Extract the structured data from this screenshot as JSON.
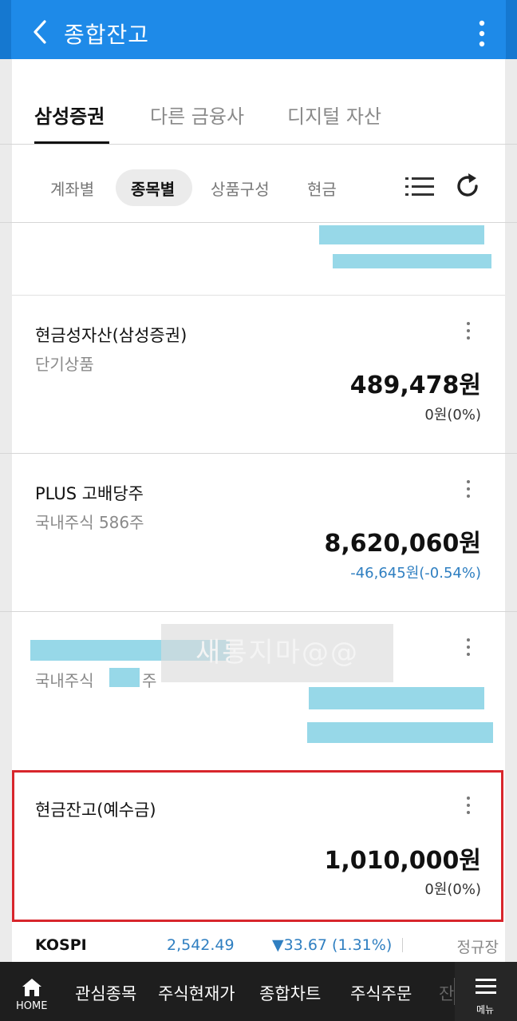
{
  "header": {
    "title": "종합잔고"
  },
  "tabs": [
    {
      "label": "삼성증권",
      "active": true
    },
    {
      "label": "다른 금융사",
      "active": false
    },
    {
      "label": "디지털 자산",
      "active": false
    }
  ],
  "subtabs": [
    {
      "label": "계좌별",
      "active": false
    },
    {
      "label": "종목별",
      "active": true
    },
    {
      "label": "상품구성",
      "active": false
    },
    {
      "label": "현금",
      "active": false
    }
  ],
  "holdings": [
    {
      "name": "현금성자산(삼성증권)",
      "sub": "단기상품",
      "amount": "489,478원",
      "change": "0원(0%)"
    },
    {
      "name": "PLUS 고배당주",
      "sub": "국내주식 586주",
      "amount": "8,620,060원",
      "change": "-46,645원(-0.54%)"
    },
    {
      "sub_prefix": "국내주식",
      "sub_suffix": "주"
    },
    {
      "name": "현금잔고(예수금)",
      "amount": "1,010,000원",
      "change": "0원(0%)"
    }
  ],
  "watermark": "새롱지마@@",
  "ticker": {
    "name": "KOSPI",
    "value": "2,542.49",
    "change": "▼33.67 (1.31%)",
    "session": "정규장"
  },
  "bottom_nav": {
    "home": "HOME",
    "items": [
      "관심종목",
      "주식현재가",
      "종합차트",
      "주식주문",
      "잔"
    ],
    "menu": "메뉴"
  },
  "colors": {
    "header_blue": "#1e8ae8",
    "down_blue": "#2f7fc1",
    "highlight_red": "#d8262c",
    "redaction": "#97d8e8"
  }
}
